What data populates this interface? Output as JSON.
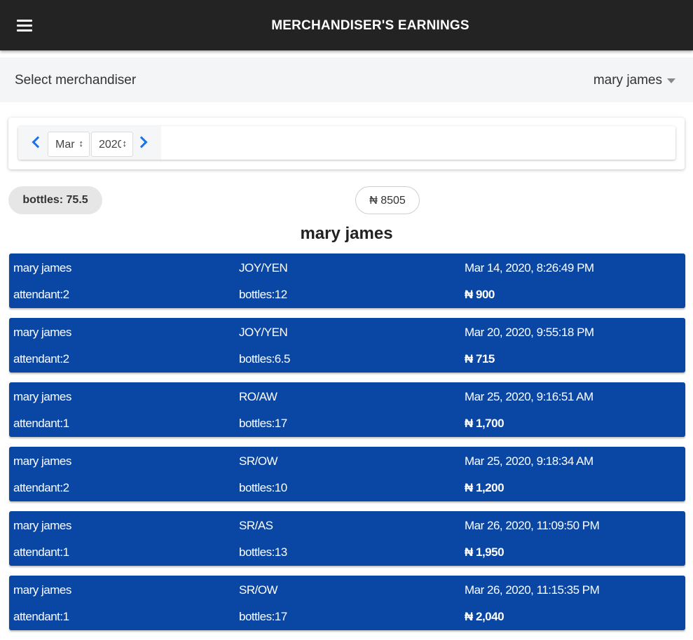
{
  "header": {
    "title": "MERCHANDISER'S EARNINGS"
  },
  "selector": {
    "label": "Select merchandiser",
    "value": "mary james"
  },
  "date_picker": {
    "month": "Mar",
    "year": "2020"
  },
  "summary": {
    "bottles": "bottles: 75.5",
    "total": "₦ 8505"
  },
  "person_title": "mary james",
  "records": [
    {
      "name": "mary james",
      "outlet": "JOY/YEN",
      "datetime": "Mar 14, 2020, 8:26:49 PM",
      "attendant": "attendant:2",
      "bottles": "bottles:12",
      "amount": "₦ 900"
    },
    {
      "name": "mary james",
      "outlet": "JOY/YEN",
      "datetime": "Mar 20, 2020, 9:55:18 PM",
      "attendant": "attendant:2",
      "bottles": "bottles:6.5",
      "amount": "₦ 715"
    },
    {
      "name": "mary james",
      "outlet": "RO/AW",
      "datetime": "Mar 25, 2020, 9:16:51 AM",
      "attendant": "attendant:1",
      "bottles": "bottles:17",
      "amount": "₦ 1,700"
    },
    {
      "name": "mary james",
      "outlet": "SR/OW",
      "datetime": "Mar 25, 2020, 9:18:34 AM",
      "attendant": "attendant:2",
      "bottles": "bottles:10",
      "amount": "₦ 1,200"
    },
    {
      "name": "mary james",
      "outlet": "SR/AS",
      "datetime": "Mar 26, 2020, 11:09:50 PM",
      "attendant": "attendant:1",
      "bottles": "bottles:13",
      "amount": "₦ 1,950"
    },
    {
      "name": "mary james",
      "outlet": "SR/OW",
      "datetime": "Mar 26, 2020, 11:15:35 PM",
      "attendant": "attendant:1",
      "bottles": "bottles:17",
      "amount": "₦ 2,040"
    }
  ],
  "colors": {
    "appbar": "#232323",
    "record_bg": "#0a46a3",
    "accent": "#1a73e8"
  },
  "icons": {
    "menu": "hamburger-menu-icon",
    "dropdown": "caret-down-icon",
    "prev": "chevron-left-icon",
    "next": "chevron-right-icon"
  }
}
